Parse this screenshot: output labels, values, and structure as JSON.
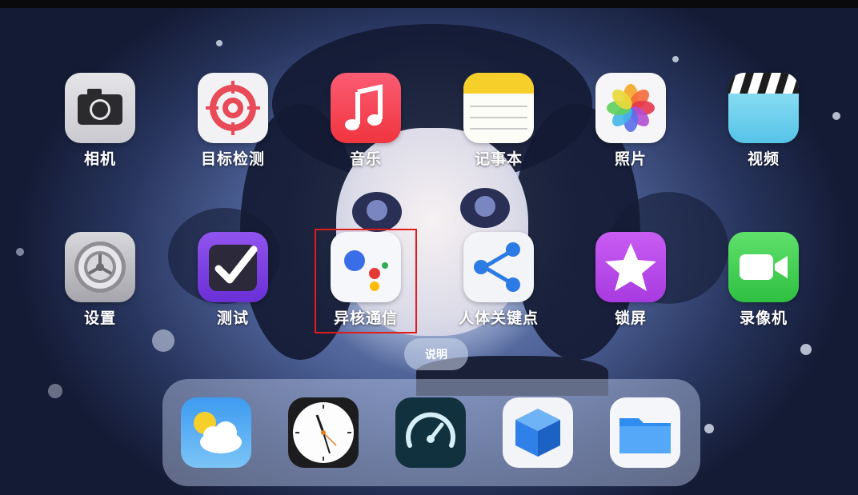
{
  "home_screen": {
    "row1": [
      {
        "label": "相机",
        "icon": "camera-icon"
      },
      {
        "label": "目标检测",
        "icon": "target-icon"
      },
      {
        "label": "音乐",
        "icon": "music-icon"
      },
      {
        "label": "记事本",
        "icon": "notes-icon"
      },
      {
        "label": "照片",
        "icon": "photos-icon"
      },
      {
        "label": "视频",
        "icon": "video-clapper-icon"
      }
    ],
    "row2": [
      {
        "label": "设置",
        "icon": "settings-gear-icon"
      },
      {
        "label": "测试",
        "icon": "checkmark-icon"
      },
      {
        "label": "异核通信",
        "icon": "assistant-dots-icon"
      },
      {
        "label": "人体关键点",
        "icon": "share-nodes-icon"
      },
      {
        "label": "锁屏",
        "icon": "star-icon"
      },
      {
        "label": "录像机",
        "icon": "video-camera-icon"
      }
    ],
    "page_hint": "说明",
    "highlighted_app": "异核通信"
  },
  "dock": {
    "apps": [
      {
        "icon": "weather-icon"
      },
      {
        "icon": "clock-icon"
      },
      {
        "icon": "speedometer-icon"
      },
      {
        "icon": "cube-icon"
      },
      {
        "icon": "folder-icon"
      }
    ]
  },
  "colors": {
    "highlight": "#e21b1b",
    "music": "#f2405a",
    "settings": "#8e8e93",
    "test": "#7b3fe0",
    "lockscreen": "#b53fe8",
    "recorder": "#3fd152"
  }
}
